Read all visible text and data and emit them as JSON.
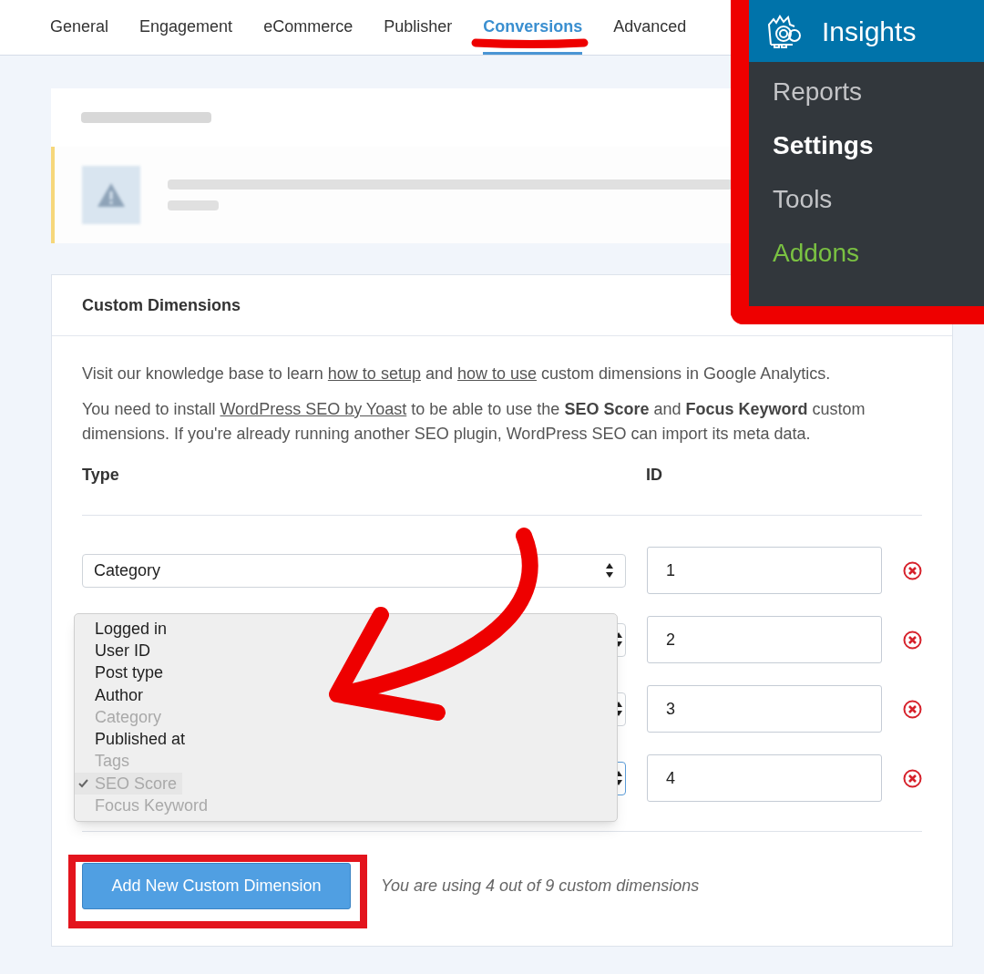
{
  "tabs": [
    {
      "label": "General",
      "selected": false
    },
    {
      "label": "Engagement",
      "selected": false
    },
    {
      "label": "eCommerce",
      "selected": false
    },
    {
      "label": "Publisher",
      "selected": false
    },
    {
      "label": "Conversions",
      "selected": true
    },
    {
      "label": "Advanced",
      "selected": false
    }
  ],
  "menu_panel": {
    "title": "Insights",
    "items": [
      {
        "label": "Reports",
        "selected": false,
        "color": "#c3c4c7"
      },
      {
        "label": "Settings",
        "selected": true,
        "color": "#ffffff"
      },
      {
        "label": "Tools",
        "selected": false,
        "color": "#c3c4c7"
      },
      {
        "label": "Addons",
        "selected": false,
        "color": "#7ac142"
      }
    ]
  },
  "dimensions_card": {
    "title": "Custom Dimensions",
    "paragraphs": [
      [
        {
          "kind": "text",
          "text": "Visit our knowledge base to learn "
        },
        {
          "kind": "link",
          "text": "how to setup"
        },
        {
          "kind": "text",
          "text": " and "
        },
        {
          "kind": "link",
          "text": "how to use"
        },
        {
          "kind": "text",
          "text": " custom dimensions in Google Analytics."
        }
      ],
      [
        {
          "kind": "text",
          "text": "You need to install "
        },
        {
          "kind": "link",
          "text": "WordPress SEO by Yoast"
        },
        {
          "kind": "text",
          "text": " to be able to use the **SEO Score** and **Focus Keyword** custom dimensions. If you're already running another SEO plugin, WordPress SEO can import its meta data."
        }
      ]
    ],
    "columns": [
      "Type",
      "ID"
    ],
    "rows": [
      {
        "type": "Category",
        "id": "1",
        "focused": false
      },
      {
        "id": "2",
        "focused": false
      },
      {
        "id": "3",
        "focused": false
      },
      {
        "id": "4",
        "focused": true
      }
    ],
    "dropdown_options": [
      {
        "label": "Logged in",
        "disabled": false,
        "selected": false
      },
      {
        "label": "User ID",
        "disabled": false,
        "selected": false
      },
      {
        "label": "Post type",
        "disabled": false,
        "selected": false
      },
      {
        "label": "Author",
        "disabled": false,
        "selected": false
      },
      {
        "label": "Category",
        "disabled": true,
        "selected": false
      },
      {
        "label": "Published at",
        "disabled": false,
        "selected": false
      },
      {
        "label": "Tags",
        "disabled": true,
        "selected": false
      },
      {
        "label": "SEO Score",
        "disabled": true,
        "selected": true
      },
      {
        "label": "Focus Keyword",
        "disabled": true,
        "selected": false
      }
    ],
    "add_button": "Add New Custom Dimension",
    "usage_note": "You are using 4 out of 9 custom dimensions"
  }
}
